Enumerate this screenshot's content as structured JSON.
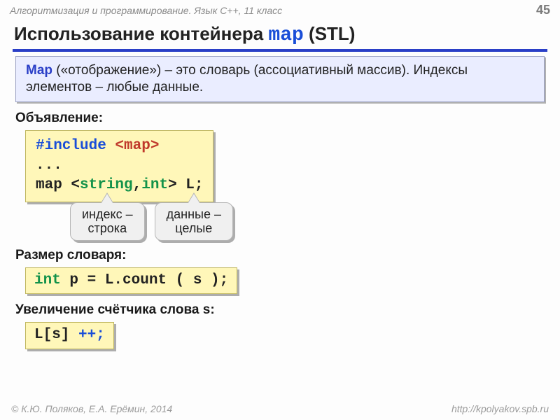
{
  "header": {
    "course": "Алгоритмизация и программирование. Язык C++, 11 класс",
    "page_number": "45"
  },
  "title": {
    "prefix": "Использование контейнера ",
    "keyword": "map",
    "suffix": " (STL)"
  },
  "definition": {
    "term": "Map ",
    "text": "(«отображение») – это словарь (ассоциативный массив). Индексы элементов – любые данные."
  },
  "sections": {
    "decl_label": "Объявление:",
    "decl_code": {
      "l1_kw": "#include",
      "l1_hdr": " <map>",
      "l2": "...",
      "l3_a": "map <",
      "l3_b": "string",
      "l3_c": ",",
      "l3_d": "int",
      "l3_e": "> L;"
    },
    "callout1": {
      "line1": "индекс –",
      "line2": "строка"
    },
    "callout2": {
      "line1": "данные –",
      "line2": "целые"
    },
    "size_label": "Размер словаря:",
    "size_code": {
      "a": "int",
      "b": " p = L.count ( s );"
    },
    "incr_label": "Увеличение счётчика слова s:",
    "incr_code": {
      "a": "L[s]",
      "b": " ++;"
    }
  },
  "footer": {
    "authors": "© К.Ю. Поляков, Е.А. Ерёмин, 2014",
    "url": "http://kpolyakov.spb.ru"
  }
}
